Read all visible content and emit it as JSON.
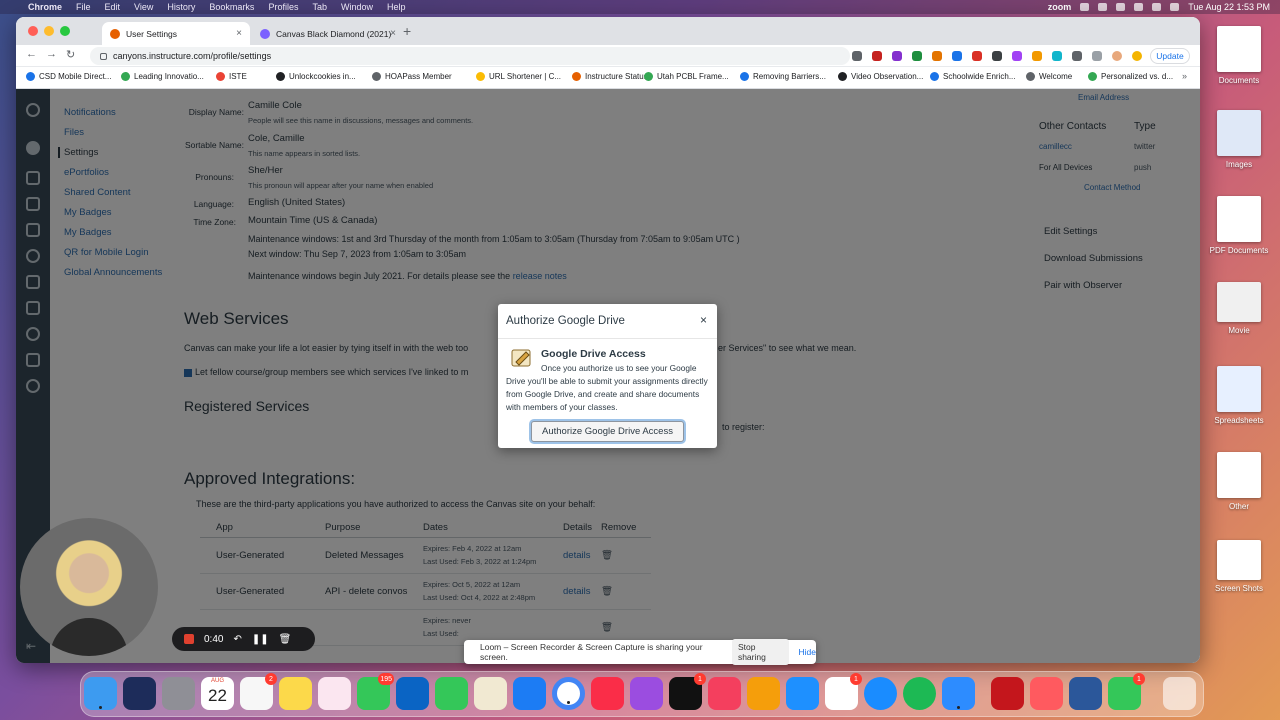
{
  "menubar": {
    "app": "Chrome",
    "items": [
      "File",
      "Edit",
      "View",
      "History",
      "Bookmarks",
      "Profiles",
      "Tab",
      "Window",
      "Help"
    ],
    "zoom": "zoom",
    "datetime": "Tue Aug 22  1:53 PM"
  },
  "browser": {
    "tabs": [
      {
        "label": "User Settings"
      },
      {
        "label": "Canvas Black Diamond (2021)"
      }
    ],
    "url": "canyons.instructure.com/profile/settings",
    "update_label": "Update",
    "bookmarks": [
      "CSD Mobile Direct...",
      "Leading Innovatio...",
      "ISTE",
      "Unlockcookies in...",
      "HOAPass Member",
      "URL Shortener | C...",
      "Instructure Status",
      "Utah PCBL Frame...",
      "Removing Barriers...",
      "Video Observation...",
      "Schoolwide Enrich...",
      "Welcome",
      "Personalized vs. d..."
    ]
  },
  "sidebar": {
    "items": [
      "Notifications",
      "Files",
      "Settings",
      "ePortfolios",
      "Shared Content",
      "My Badges",
      "My Badges",
      "QR for Mobile Login",
      "Global Announcements"
    ]
  },
  "profile": {
    "display_name_label": "Display Name:",
    "display_name": "Camille Cole",
    "display_name_hint": "People will see this name in discussions, messages and comments.",
    "sortable_name_label": "Sortable Name:",
    "sortable_name": "Cole, Camille",
    "sortable_name_hint": "This name appears in sorted lists.",
    "pronouns_label": "Pronouns:",
    "pronouns": "She/Her",
    "pronouns_hint": "This pronoun will appear after your name when enabled",
    "language_label": "Language:",
    "language": "English (United States)",
    "timezone_label": "Time Zone:",
    "timezone": "Mountain Time (US & Canada)",
    "maintenance1": "Maintenance windows: 1st and 3rd Thursday of the month from 1:05am to 3:05am (Thursday from 7:05am to 9:05am UTC )",
    "maintenance2": "Next window: Thu Sep 7, 2023 from 1:05am to 3:05am",
    "maintenance3": "Maintenance windows begin July 2021. For details please see the",
    "release_notes": "release notes"
  },
  "web_services": {
    "heading": "Web Services",
    "desc": "Canvas can make your life a lot easier by tying itself in with the web too",
    "desc_tail": "er Services\" to see what we mean.",
    "checkbox_label": "Let fellow course/group members see which services I've linked to m",
    "registered_heading": "Registered Services",
    "register_tail": "to register:"
  },
  "integrations": {
    "heading": "Approved Integrations:",
    "desc": "These are the third-party applications you have authorized to access the Canvas site on your behalf:",
    "columns": [
      "App",
      "Purpose",
      "Dates",
      "Details",
      "Remove"
    ],
    "rows": [
      {
        "app": "User-Generated",
        "purpose": "Deleted Messages",
        "expires": "Expires:    Feb 4, 2022 at 12am",
        "last_used": "Last Used:  Feb 3, 2022 at 1:24pm",
        "details": "details"
      },
      {
        "app": "User-Generated",
        "purpose": "API - delete convos",
        "expires": "Expires:    Oct 5, 2022 at 12am",
        "last_used": "Last Used:  Oct 4, 2022 at 2:48pm",
        "details": "details"
      },
      {
        "app": "",
        "purpose": "",
        "expires": "Expires:    never",
        "last_used": "Last Used:",
        "details": ""
      }
    ]
  },
  "right_side": {
    "email_link": "Email Address",
    "other_contacts": "Other Contacts",
    "type": "Type",
    "contacts": [
      {
        "name": "camillecc",
        "type": "twitter"
      },
      {
        "name": "For All Devices",
        "type": "push"
      }
    ],
    "contact_method": "Contact Method",
    "edit_settings": "Edit Settings",
    "download_submissions": "Download Submissions",
    "pair_observer": "Pair with Observer"
  },
  "dialog": {
    "title": "Authorize Google Drive",
    "close": "×",
    "subtitle": "Google Drive Access",
    "body": "Once you authorize us to see your Google Drive you'll be able to submit your assignments directly from Google Drive, and create and share documents with members of your classes.",
    "button": "Authorize Google Drive Access"
  },
  "loom": {
    "timer": "0:40",
    "share_msg": "Loom – Screen Recorder & Screen Capture is sharing your screen.",
    "stop": "Stop sharing",
    "hide": "Hide"
  },
  "desktop": {
    "icons": [
      "Documents",
      "Images",
      "PDF Documents",
      "Movie",
      "Spreadsheets",
      "Other",
      "Screen Shots"
    ]
  },
  "dock": {
    "calendar_day": "22",
    "calendar_month": "AUG",
    "badges": {
      "reminders": "2",
      "messages": "195",
      "tv": "1",
      "slack": "1",
      "misc": "1"
    }
  }
}
